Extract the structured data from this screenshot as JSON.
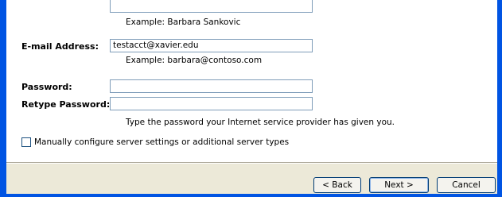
{
  "form": {
    "name_hint": "Example: Barbara Sankovic",
    "email_label": "E-mail Address:",
    "email_value": "testacct@xavier.edu",
    "email_hint": "Example: barbara@contoso.com",
    "password_label": "Password:",
    "password_value": "",
    "retype_label": "Retype Password:",
    "retype_value": "",
    "password_hint": "Type the password your Internet service provider has given you."
  },
  "options": {
    "manual_config_label": "Manually configure server settings or additional server types",
    "manual_config_checked": false
  },
  "buttons": {
    "back_label": "< Back",
    "next_label": "Next >",
    "cancel_label": "Cancel"
  },
  "colors": {
    "window_border": "#0054e3",
    "footer_background": "#ece9d8",
    "textbox_border": "#7f9db9"
  }
}
